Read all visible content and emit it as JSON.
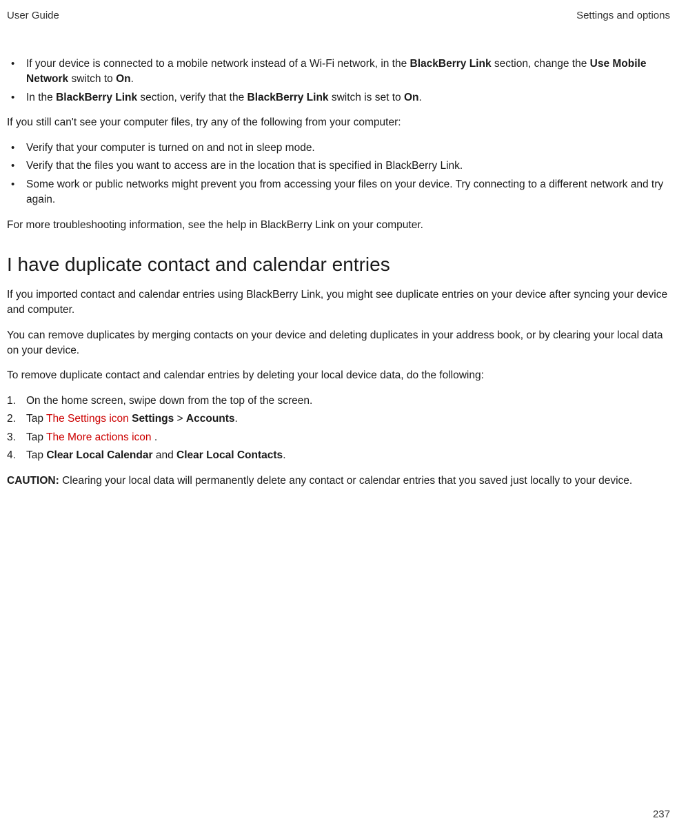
{
  "header": {
    "left": "User Guide",
    "right": "Settings and options"
  },
  "section1": {
    "bullets": [
      {
        "prefix": "If your device is connected to a mobile network instead of a Wi-Fi network, in the ",
        "bold1": "BlackBerry Link",
        "mid1": " section, change the ",
        "bold2": "Use Mobile Network",
        "mid2": " switch to ",
        "bold3": "On",
        "suffix": "."
      },
      {
        "prefix": "In the ",
        "bold1": "BlackBerry Link",
        "mid1": " section, verify that the ",
        "bold2": "BlackBerry Link",
        "mid2": " switch is set to ",
        "bold3": "On",
        "suffix": "."
      }
    ],
    "para1": "If you still can't see your computer files, try any of the following from your computer:",
    "bullets2": [
      "Verify that your computer is turned on and not in sleep mode.",
      "Verify that the files you want to access are in the location that is specified in BlackBerry Link.",
      "Some work or public networks might prevent you from accessing your files on your device. Try connecting to a different network and try again."
    ],
    "para2": "For more troubleshooting information, see the help in BlackBerry Link on your computer."
  },
  "section2": {
    "heading": "I have duplicate contact and calendar entries",
    "para1": "If you imported contact and calendar entries using BlackBerry Link, you might see duplicate entries on your device after syncing your device and computer.",
    "para2": "You can remove duplicates by merging contacts on your device and deleting duplicates in your address book, or by clearing your local data on your device.",
    "para3": "To remove duplicate contact and calendar entries by deleting your local device data, do the following:",
    "steps": {
      "s1": "On the home screen, swipe down from the top of the screen.",
      "s2": {
        "prefix": "Tap  ",
        "red": "The Settings icon",
        "bold1": " Settings",
        "mid": " > ",
        "bold2": "Accounts",
        "suffix": "."
      },
      "s3": {
        "prefix": "Tap  ",
        "red": "The More actions icon",
        "suffix": " ."
      },
      "s4": {
        "prefix": "Tap ",
        "bold1": "Clear Local Calendar",
        "mid": " and ",
        "bold2": "Clear Local Contacts",
        "suffix": "."
      }
    },
    "caution": {
      "label": "CAUTION:",
      "text": " Clearing your local data will permanently delete any contact or calendar entries that you saved just locally to your device."
    }
  },
  "pageNumber": "237"
}
